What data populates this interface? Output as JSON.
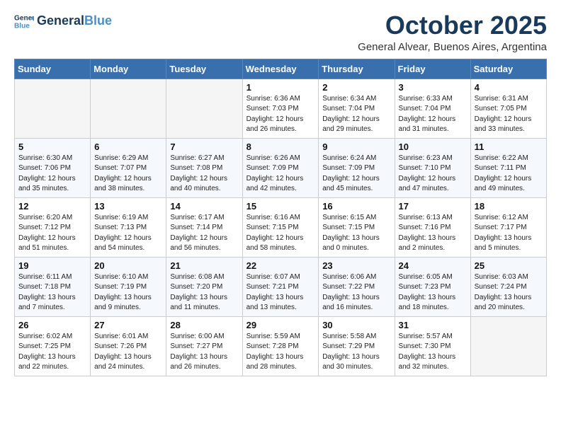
{
  "header": {
    "logo_general": "General",
    "logo_blue": "Blue",
    "month": "October 2025",
    "location": "General Alvear, Buenos Aires, Argentina"
  },
  "days_of_week": [
    "Sunday",
    "Monday",
    "Tuesday",
    "Wednesday",
    "Thursday",
    "Friday",
    "Saturday"
  ],
  "weeks": [
    [
      {
        "day": "",
        "info": ""
      },
      {
        "day": "",
        "info": ""
      },
      {
        "day": "",
        "info": ""
      },
      {
        "day": "1",
        "info": "Sunrise: 6:36 AM\nSunset: 7:03 PM\nDaylight: 12 hours\nand 26 minutes."
      },
      {
        "day": "2",
        "info": "Sunrise: 6:34 AM\nSunset: 7:04 PM\nDaylight: 12 hours\nand 29 minutes."
      },
      {
        "day": "3",
        "info": "Sunrise: 6:33 AM\nSunset: 7:04 PM\nDaylight: 12 hours\nand 31 minutes."
      },
      {
        "day": "4",
        "info": "Sunrise: 6:31 AM\nSunset: 7:05 PM\nDaylight: 12 hours\nand 33 minutes."
      }
    ],
    [
      {
        "day": "5",
        "info": "Sunrise: 6:30 AM\nSunset: 7:06 PM\nDaylight: 12 hours\nand 35 minutes."
      },
      {
        "day": "6",
        "info": "Sunrise: 6:29 AM\nSunset: 7:07 PM\nDaylight: 12 hours\nand 38 minutes."
      },
      {
        "day": "7",
        "info": "Sunrise: 6:27 AM\nSunset: 7:08 PM\nDaylight: 12 hours\nand 40 minutes."
      },
      {
        "day": "8",
        "info": "Sunrise: 6:26 AM\nSunset: 7:09 PM\nDaylight: 12 hours\nand 42 minutes."
      },
      {
        "day": "9",
        "info": "Sunrise: 6:24 AM\nSunset: 7:09 PM\nDaylight: 12 hours\nand 45 minutes."
      },
      {
        "day": "10",
        "info": "Sunrise: 6:23 AM\nSunset: 7:10 PM\nDaylight: 12 hours\nand 47 minutes."
      },
      {
        "day": "11",
        "info": "Sunrise: 6:22 AM\nSunset: 7:11 PM\nDaylight: 12 hours\nand 49 minutes."
      }
    ],
    [
      {
        "day": "12",
        "info": "Sunrise: 6:20 AM\nSunset: 7:12 PM\nDaylight: 12 hours\nand 51 minutes."
      },
      {
        "day": "13",
        "info": "Sunrise: 6:19 AM\nSunset: 7:13 PM\nDaylight: 12 hours\nand 54 minutes."
      },
      {
        "day": "14",
        "info": "Sunrise: 6:17 AM\nSunset: 7:14 PM\nDaylight: 12 hours\nand 56 minutes."
      },
      {
        "day": "15",
        "info": "Sunrise: 6:16 AM\nSunset: 7:15 PM\nDaylight: 12 hours\nand 58 minutes."
      },
      {
        "day": "16",
        "info": "Sunrise: 6:15 AM\nSunset: 7:15 PM\nDaylight: 13 hours\nand 0 minutes."
      },
      {
        "day": "17",
        "info": "Sunrise: 6:13 AM\nSunset: 7:16 PM\nDaylight: 13 hours\nand 2 minutes."
      },
      {
        "day": "18",
        "info": "Sunrise: 6:12 AM\nSunset: 7:17 PM\nDaylight: 13 hours\nand 5 minutes."
      }
    ],
    [
      {
        "day": "19",
        "info": "Sunrise: 6:11 AM\nSunset: 7:18 PM\nDaylight: 13 hours\nand 7 minutes."
      },
      {
        "day": "20",
        "info": "Sunrise: 6:10 AM\nSunset: 7:19 PM\nDaylight: 13 hours\nand 9 minutes."
      },
      {
        "day": "21",
        "info": "Sunrise: 6:08 AM\nSunset: 7:20 PM\nDaylight: 13 hours\nand 11 minutes."
      },
      {
        "day": "22",
        "info": "Sunrise: 6:07 AM\nSunset: 7:21 PM\nDaylight: 13 hours\nand 13 minutes."
      },
      {
        "day": "23",
        "info": "Sunrise: 6:06 AM\nSunset: 7:22 PM\nDaylight: 13 hours\nand 16 minutes."
      },
      {
        "day": "24",
        "info": "Sunrise: 6:05 AM\nSunset: 7:23 PM\nDaylight: 13 hours\nand 18 minutes."
      },
      {
        "day": "25",
        "info": "Sunrise: 6:03 AM\nSunset: 7:24 PM\nDaylight: 13 hours\nand 20 minutes."
      }
    ],
    [
      {
        "day": "26",
        "info": "Sunrise: 6:02 AM\nSunset: 7:25 PM\nDaylight: 13 hours\nand 22 minutes."
      },
      {
        "day": "27",
        "info": "Sunrise: 6:01 AM\nSunset: 7:26 PM\nDaylight: 13 hours\nand 24 minutes."
      },
      {
        "day": "28",
        "info": "Sunrise: 6:00 AM\nSunset: 7:27 PM\nDaylight: 13 hours\nand 26 minutes."
      },
      {
        "day": "29",
        "info": "Sunrise: 5:59 AM\nSunset: 7:28 PM\nDaylight: 13 hours\nand 28 minutes."
      },
      {
        "day": "30",
        "info": "Sunrise: 5:58 AM\nSunset: 7:29 PM\nDaylight: 13 hours\nand 30 minutes."
      },
      {
        "day": "31",
        "info": "Sunrise: 5:57 AM\nSunset: 7:30 PM\nDaylight: 13 hours\nand 32 minutes."
      },
      {
        "day": "",
        "info": ""
      }
    ]
  ]
}
